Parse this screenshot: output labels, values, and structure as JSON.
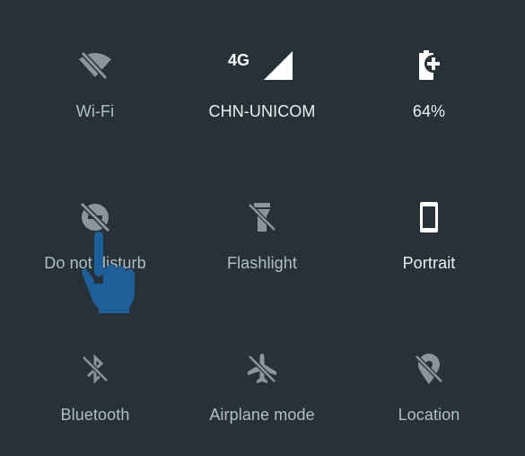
{
  "quick_settings": {
    "tiles": [
      {
        "label": "Wi-Fi",
        "icon": "wifi-off-icon",
        "state": "off"
      },
      {
        "label": "CHN-UNICOM",
        "icon": "cellular-signal-icon",
        "badge": "4G",
        "state": "on"
      },
      {
        "label": "64%",
        "icon": "battery-saver-icon",
        "state": "on"
      },
      {
        "label": "Do not disturb",
        "icon": "do-not-disturb-off-icon",
        "state": "off"
      },
      {
        "label": "Flashlight",
        "icon": "flashlight-off-icon",
        "state": "off"
      },
      {
        "label": "Portrait",
        "icon": "portrait-orientation-icon",
        "state": "on"
      },
      {
        "label": "Bluetooth",
        "icon": "bluetooth-off-icon",
        "state": "off"
      },
      {
        "label": "Airplane mode",
        "icon": "airplane-mode-off-icon",
        "state": "off"
      },
      {
        "label": "Location",
        "icon": "location-off-icon",
        "state": "off"
      }
    ]
  },
  "overlay": {
    "icon": "tap-hand-icon"
  },
  "colors": {
    "background": "#263238",
    "active": "#ffffff",
    "inactive": "#8a969b",
    "hand": "#1e5f9a"
  }
}
